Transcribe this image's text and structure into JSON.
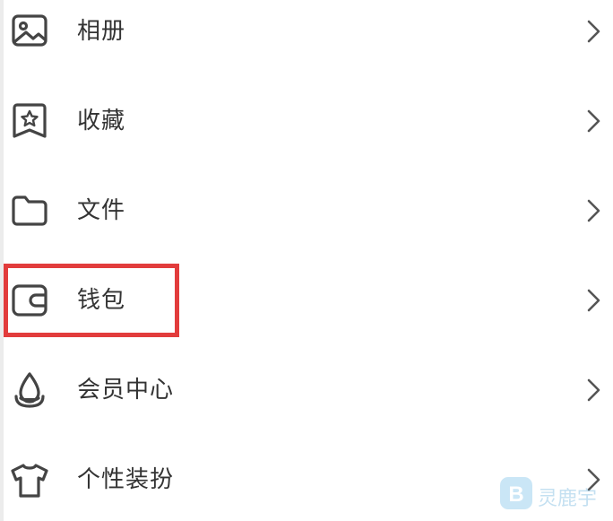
{
  "menu": {
    "items": [
      {
        "label": "相册",
        "icon": "photo-album-icon"
      },
      {
        "label": "收藏",
        "icon": "favorites-star-icon"
      },
      {
        "label": "文件",
        "icon": "folder-icon"
      },
      {
        "label": "钱包",
        "icon": "wallet-icon"
      },
      {
        "label": "会员中心",
        "icon": "member-center-icon"
      },
      {
        "label": "个性装扮",
        "icon": "t-shirt-icon"
      }
    ],
    "highlighted_item": "钱包"
  },
  "colors": {
    "text": "#333333",
    "icon_stroke": "#444444",
    "chevron": "#555555",
    "highlight_border": "#e23c3c"
  },
  "watermark": {
    "text": "灵鹿宇"
  }
}
